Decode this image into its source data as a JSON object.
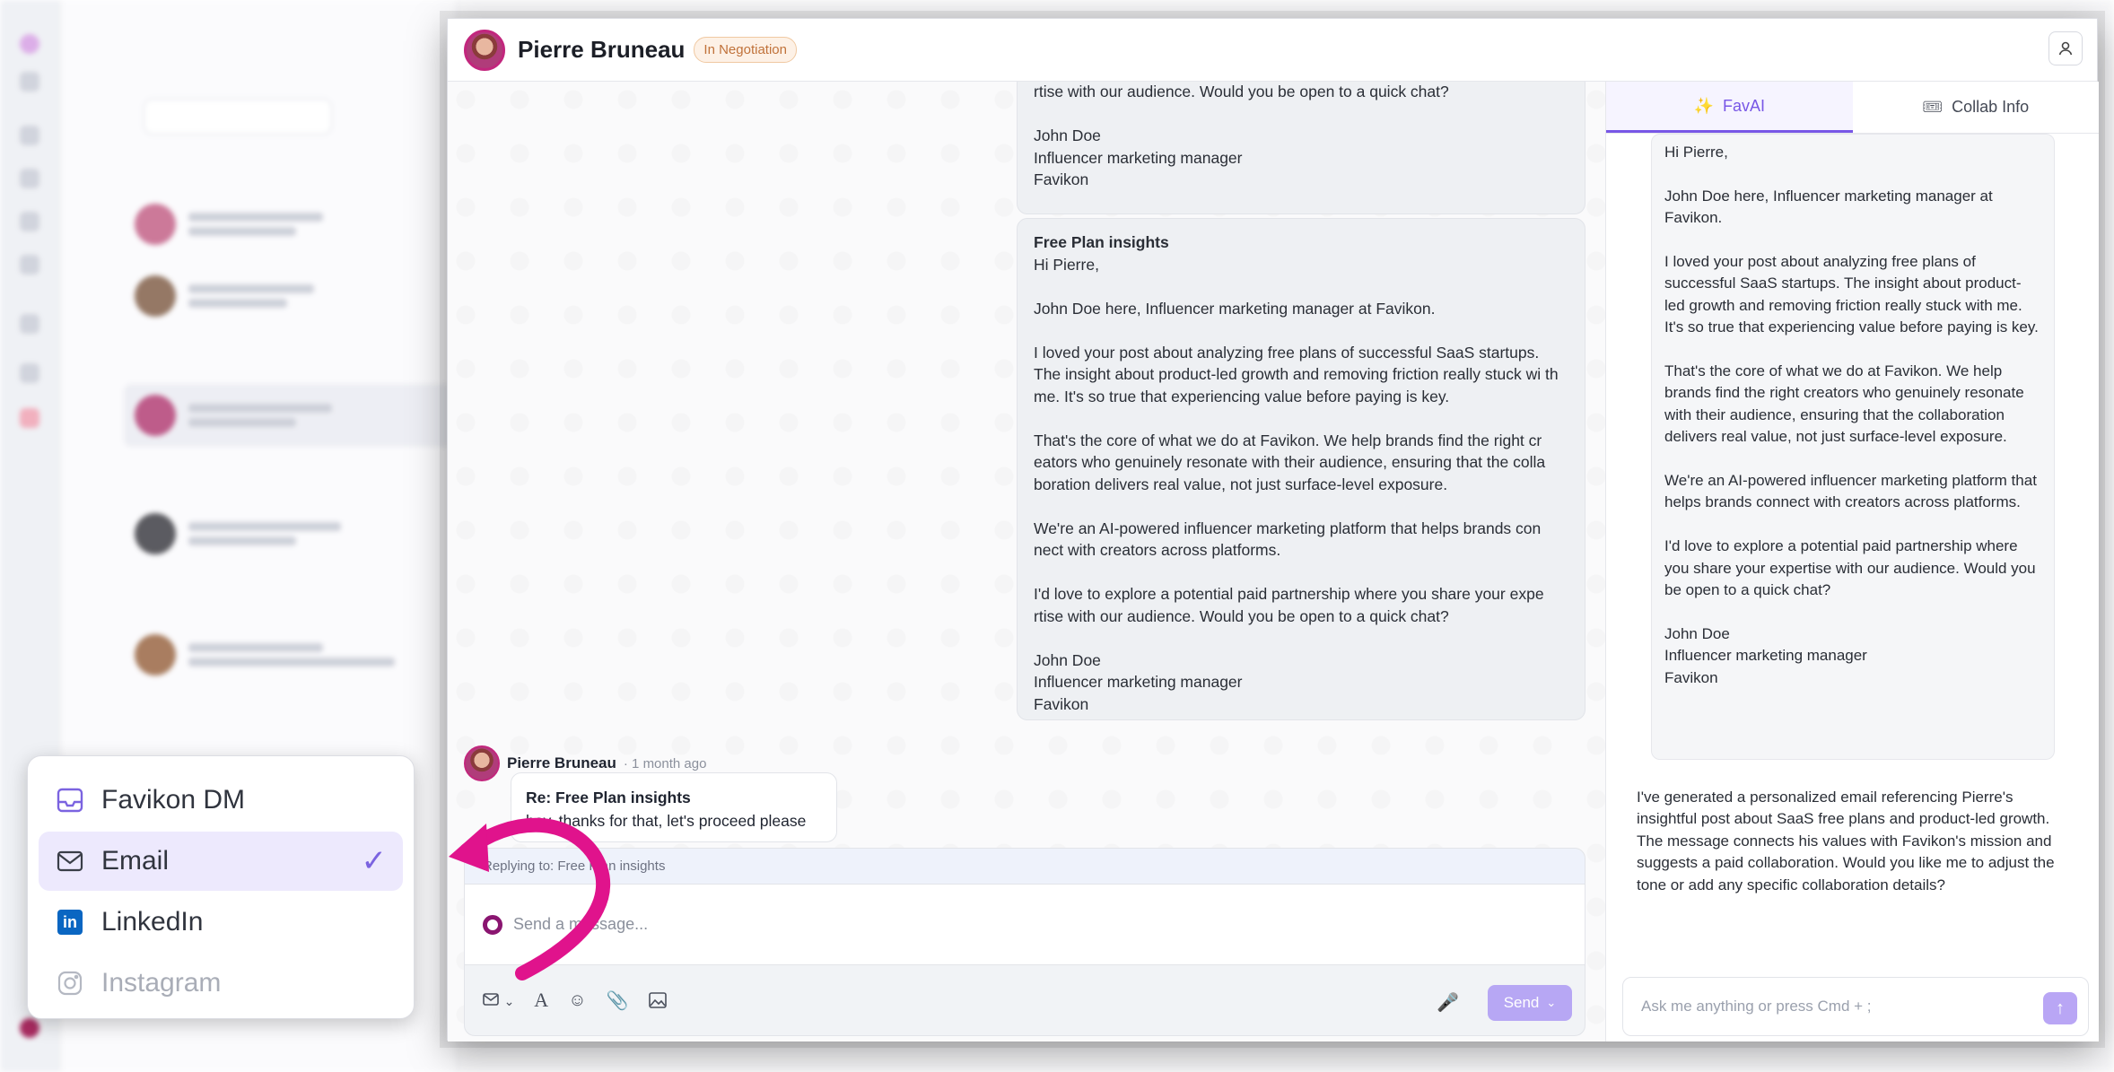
{
  "header": {
    "contact_name": "Pierre Bruneau",
    "status": "In Negotiation"
  },
  "channel_menu": {
    "items": [
      {
        "label": "Favikon DM",
        "icon": "inbox-icon",
        "state": "normal"
      },
      {
        "label": "Email",
        "icon": "mail-icon",
        "state": "selected"
      },
      {
        "label": "LinkedIn",
        "icon": "linkedin-icon",
        "state": "normal"
      },
      {
        "label": "Instagram",
        "icon": "instagram-icon",
        "state": "disabled"
      }
    ]
  },
  "chat": {
    "truncated_message": {
      "lines": [
        "rtise with our audience. Would you be open to a quick chat?",
        "John Doe",
        "Influencer marketing manager",
        "Favikon"
      ]
    },
    "sent_message": {
      "subject": "Free Plan insights",
      "greeting": "Hi Pierre,",
      "intro": "John Doe here, Influencer marketing manager at Favikon.",
      "p1": "I loved your post about analyzing free plans of successful SaaS startups. The insight about product-led growth and removing friction really stuck wi th me. It's so true that experiencing value before paying is key.",
      "p2": "That's the core of what we do at Favikon. We help brands find the right cr eators who genuinely resonate with their audience, ensuring that the colla boration delivers real value, not just surface-level exposure.",
      "p3": "We're an AI-powered influencer marketing platform that helps brands con nect with creators across platforms.",
      "p4": "I'd love to explore a potential paid partnership where you share your expe rtise with our audience. Would you be open to a quick chat?",
      "sig_name": "John Doe",
      "sig_title": "Influencer marketing manager",
      "sig_company": "Favikon"
    },
    "reply": {
      "author": "Pierre Bruneau",
      "time": "· 1 month ago",
      "subject": "Re: Free Plan insights",
      "body": "hey, thanks for that, let's proceed please"
    },
    "composer": {
      "replying_to": "Replying to: Free Plan insights",
      "placeholder": "Send a message...",
      "send_label": "Send"
    }
  },
  "side_panel": {
    "tabs": [
      {
        "label": "FavAI",
        "icon": "sparkle-icon",
        "active": true
      },
      {
        "label": "Collab Info",
        "icon": "ticket-icon",
        "active": false
      }
    ],
    "draft": {
      "greeting": "Hi Pierre,",
      "intro": "John Doe here, Influencer marketing manager at Favikon.",
      "p1": "I loved your post about analyzing free plans of successful SaaS startups. The insight about product-led growth and removing friction really stuck with me. It's so true that experiencing value before paying is key.",
      "p2": "That's the core of what we do at Favikon. We help brands find the right creators who genuinely resonate with their audience, ensuring that the collaboration delivers real value, not just surface-level exposure.",
      "p3": "We're an AI-powered influencer marketing platform that helps brands connect with creators across platforms.",
      "p4": "I'd love to explore a potential paid partnership where you share your expertise with our audience. Would you be open to a quick chat?",
      "sig_name": "John Doe",
      "sig_title": "Influencer marketing manager",
      "sig_company": "Favikon"
    },
    "ai_message": "I've generated a personalized email referencing Pierre's insightful post about SaaS free plans and product-led growth. The message connects his values with Favikon's mission and suggests a paid collaboration. Would you like me to adjust the tone or add any specific collaboration details?",
    "ai_input_placeholder": "Ask me anything or press Cmd + ;"
  },
  "colors": {
    "accent": "#7857e6",
    "status_badge": "#c0723a",
    "arrow": "#e0138c"
  }
}
